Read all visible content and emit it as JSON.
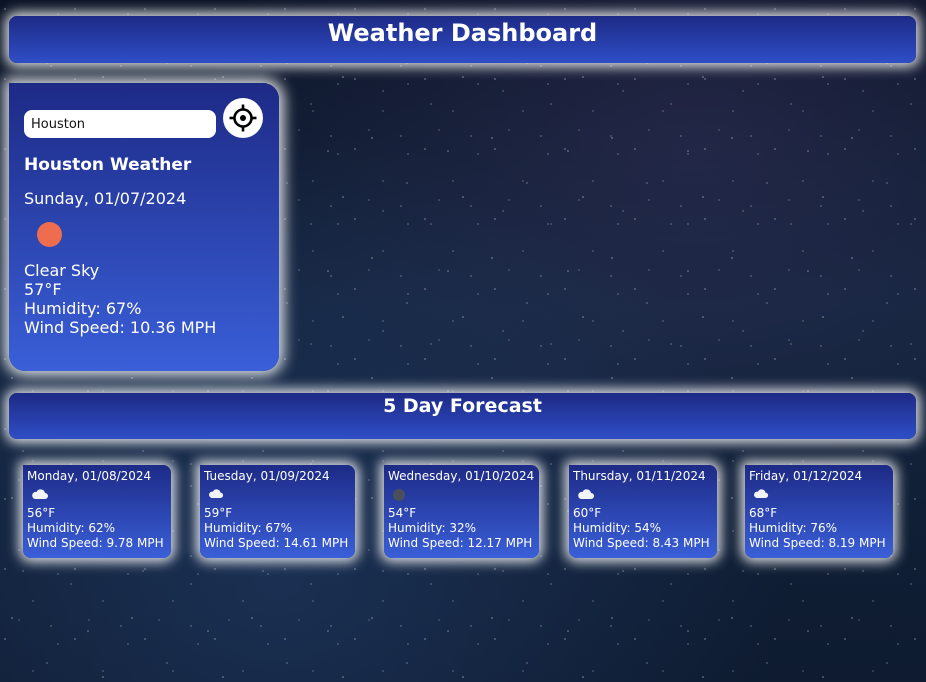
{
  "header": {
    "title": "Weather Dashboard"
  },
  "search": {
    "value": "Houston",
    "locate_icon": "crosshair-icon"
  },
  "current": {
    "city_heading": "Houston Weather",
    "date": "Sunday, 01/07/2024",
    "icon": "sun-icon",
    "condition": "Clear Sky",
    "temperature": "57°F",
    "humidity": "Humidity: 67%",
    "wind": "Wind Speed: 10.36 MPH"
  },
  "forecast": {
    "title": "5 Day Forecast",
    "days": [
      {
        "date": "Monday, 01/08/2024",
        "icon": "cloud-icon",
        "temp": "56°F",
        "humidity": "Humidity: 62%",
        "wind": "Wind Speed: 9.78 MPH"
      },
      {
        "date": "Tuesday, 01/09/2024",
        "icon": "cloud-icon",
        "temp": "59°F",
        "humidity": "Humidity: 67%",
        "wind": "Wind Speed: 14.61 MPH"
      },
      {
        "date": "Wednesday, 01/10/2024",
        "icon": "dark-cloud-icon",
        "temp": "54°F",
        "humidity": "Humidity: 32%",
        "wind": "Wind Speed: 12.17 MPH"
      },
      {
        "date": "Thursday, 01/11/2024",
        "icon": "cloud-icon",
        "temp": "60°F",
        "humidity": "Humidity: 54%",
        "wind": "Wind Speed: 8.43 MPH"
      },
      {
        "date": "Friday, 01/12/2024",
        "icon": "cloud-icon",
        "temp": "68°F",
        "humidity": "Humidity: 76%",
        "wind": "Wind Speed: 8.19 MPH"
      }
    ]
  },
  "colors": {
    "card_top": "#1d2a86",
    "card_bottom": "#3a5fd8",
    "sun": "#ee6d4f"
  }
}
